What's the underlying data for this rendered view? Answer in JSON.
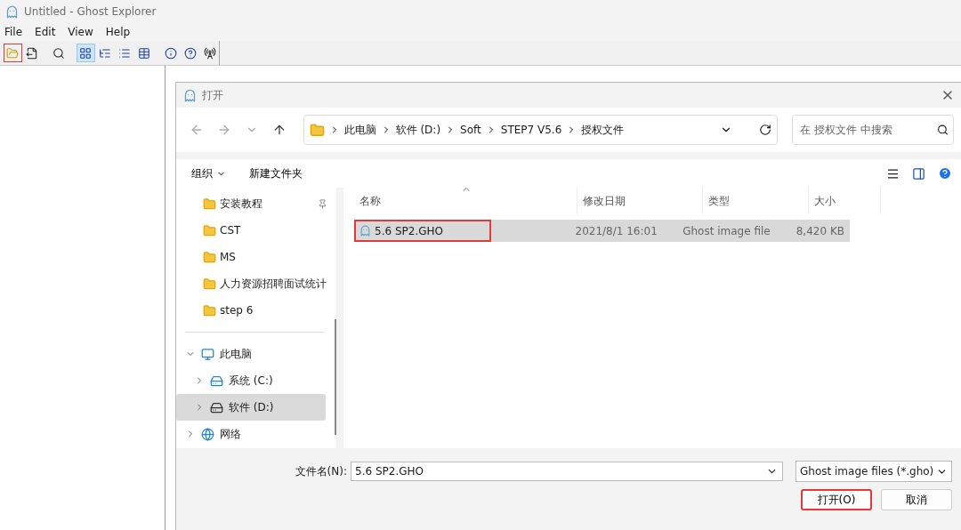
{
  "app": {
    "title": "Untitled - Ghost Explorer",
    "menu": [
      "File",
      "Edit",
      "View",
      "Help"
    ],
    "toolbar": [
      {
        "kind": "open",
        "pressed": false,
        "highlighted": true
      },
      {
        "kind": "extract",
        "pressed": false,
        "highlighted": false
      },
      {
        "kind": "find",
        "pressed": false,
        "highlighted": false
      },
      {
        "kind": "icons",
        "pressed": true,
        "highlighted": false
      },
      {
        "kind": "tree",
        "pressed": false,
        "highlighted": false
      },
      {
        "kind": "list",
        "pressed": false,
        "highlighted": false
      },
      {
        "kind": "details",
        "pressed": false,
        "highlighted": false
      },
      {
        "kind": "info",
        "pressed": false,
        "highlighted": false
      },
      {
        "kind": "help",
        "pressed": false,
        "highlighted": false
      },
      {
        "kind": "network",
        "pressed": false,
        "highlighted": false
      }
    ]
  },
  "dialog": {
    "title": "打开",
    "breadcrumb": [
      "此电脑",
      "软件 (D:)",
      "Soft",
      "STEP7 V5.6",
      "授权文件"
    ],
    "search": {
      "placeholder": "在 授权文件 中搜索"
    },
    "commands": [
      {
        "label": "组织",
        "dropdown": true
      },
      {
        "label": "新建文件夹",
        "dropdown": false
      }
    ],
    "quick_access": [
      {
        "label": "安装教程",
        "pinned": true
      },
      {
        "label": "CST",
        "pinned": false
      },
      {
        "label": "MS",
        "pinned": false
      },
      {
        "label": "人力资源招聘面试统计",
        "pinned": false
      },
      {
        "label": "step 6",
        "pinned": false
      }
    ],
    "tree": [
      {
        "label": "此电脑",
        "kind": "pc",
        "expanded": true,
        "selected": false,
        "children": [
          {
            "label": "系统 (C:)",
            "kind": "system-drive",
            "expanded": false,
            "selected": false
          },
          {
            "label": "软件 (D:)",
            "kind": "drive",
            "expanded": false,
            "selected": true
          }
        ]
      },
      {
        "label": "网络",
        "kind": "network",
        "expanded": false,
        "selected": false
      }
    ],
    "columns": [
      "名称",
      "修改日期",
      "类型",
      "大小"
    ],
    "rows": [
      {
        "cells": [
          "5.6 SP2.GHO",
          "2021/8/1 16:01",
          "Ghost image file",
          "8,420 KB"
        ],
        "selected": true,
        "highlighted": true
      }
    ],
    "filename": {
      "label": "文件名(N):",
      "value": "5.6 SP2.GHO"
    },
    "filetype": "Ghost image files (*.gho)",
    "buttons": [
      {
        "label": "打开(O)",
        "highlighted": true
      },
      {
        "label": "取消",
        "highlighted": false
      }
    ]
  }
}
